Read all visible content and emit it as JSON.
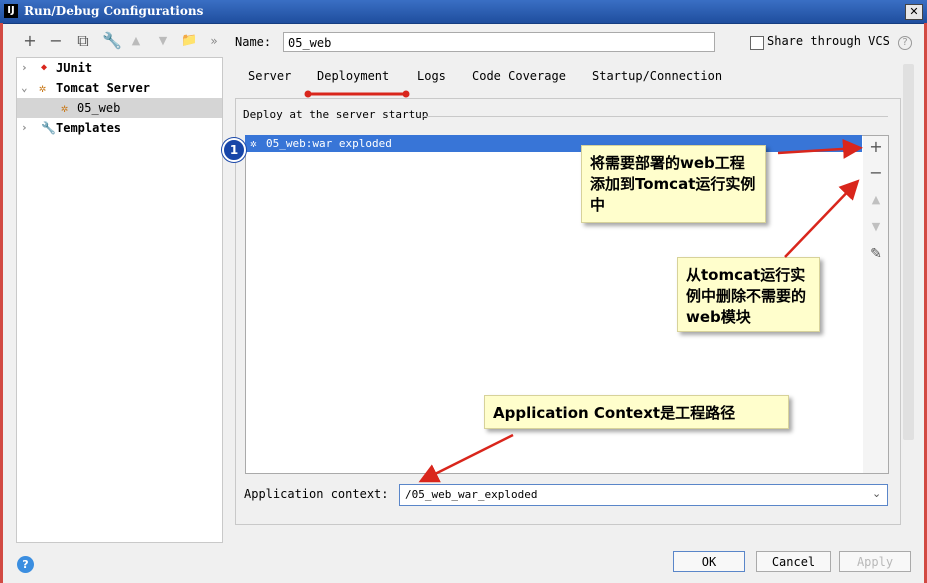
{
  "window": {
    "title": "Run/Debug Configurations",
    "app_icon": "IJ",
    "close": "✕"
  },
  "toolbar": {
    "add": "+",
    "remove": "−",
    "copy": "⧉",
    "edit": "🔧",
    "up": "▲",
    "down": "▼",
    "folder": "📁",
    "more": "»"
  },
  "tree": {
    "items": [
      {
        "label": "JUnit",
        "icon": "junit-icon"
      },
      {
        "label": "Tomcat Server",
        "icon": "tomcat-icon"
      },
      {
        "label": "05_web",
        "icon": "tomcat-icon"
      },
      {
        "label": "Templates",
        "icon": "wrench-icon"
      }
    ]
  },
  "name": {
    "label": "Name:",
    "value": "05_web"
  },
  "share": {
    "label": "Share through VCS",
    "help": "?"
  },
  "tabs": [
    "Server",
    "Deployment",
    "Logs",
    "Code Coverage",
    "Startup/Connection"
  ],
  "deployment": {
    "section_label": "Deploy at the server startup",
    "badge": "1",
    "artifacts": [
      "05_web:war exploded"
    ]
  },
  "side_tools": {
    "add": "+",
    "remove": "−",
    "up": "▲",
    "down": "▼",
    "edit": "✎"
  },
  "callouts": {
    "add": "将需要部署的web工程添加到Tomcat运行实例中",
    "remove": "从tomcat运行实例中删除不需要的web模块",
    "context": "Application Context是工程路径"
  },
  "app_context": {
    "label": "Application context:",
    "value": "/05_web_war_exploded"
  },
  "buttons": {
    "ok": "OK",
    "cancel": "Cancel",
    "apply": "Apply",
    "help": "?"
  },
  "colors": {
    "selection": "#3875d7",
    "annotation": "#d9261c",
    "callout_bg": "#fffecc",
    "badge": "#1846a8"
  }
}
